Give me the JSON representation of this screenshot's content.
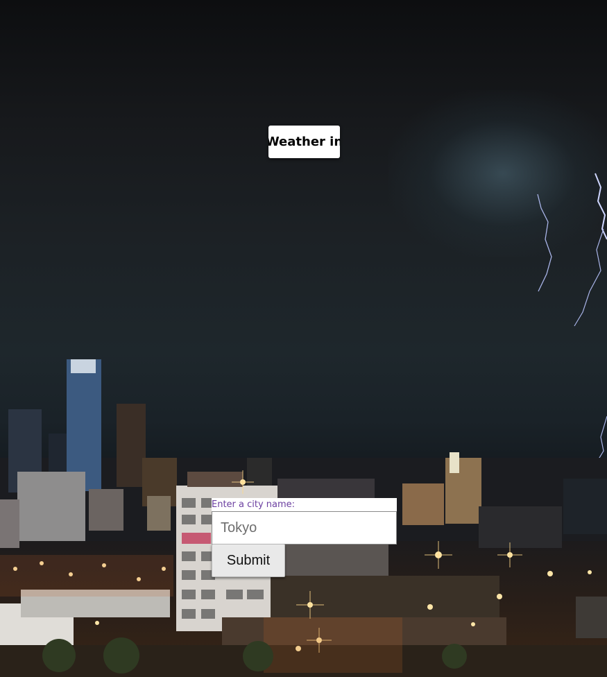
{
  "header": {
    "title": "Weather in"
  },
  "search": {
    "label": "Enter a city name:",
    "placeholder": "Tokyo",
    "value": ""
  },
  "actions": {
    "submit_label": "Submit"
  },
  "background": {
    "icon": "stormy-city-skyline-background"
  }
}
